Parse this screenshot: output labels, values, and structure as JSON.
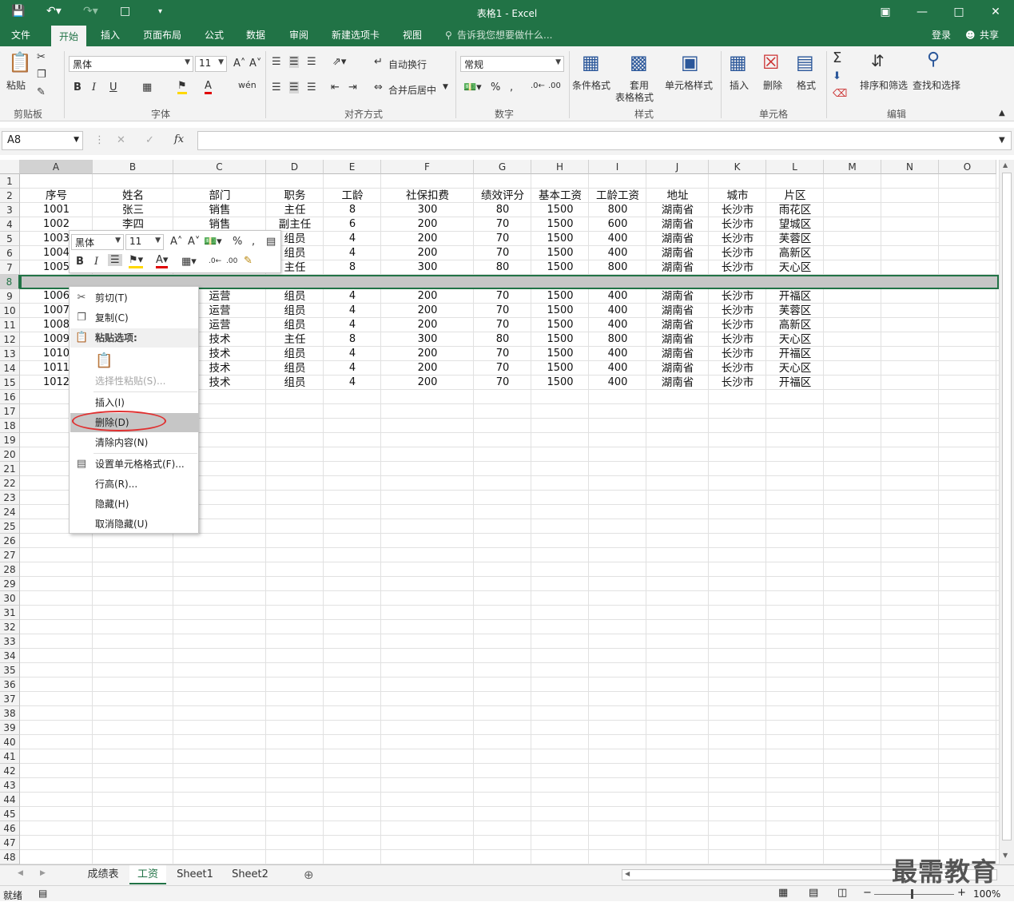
{
  "window": {
    "title": "表格1 - Excel"
  },
  "tabs": [
    "文件",
    "开始",
    "插入",
    "页面布局",
    "公式",
    "数据",
    "审阅",
    "新建选项卡",
    "视图"
  ],
  "tellme": "告诉我您想要做什么...",
  "account": {
    "login": "登录",
    "share": "共享"
  },
  "ribbon": {
    "paste": "粘贴",
    "font_name": "黑体",
    "font_size": "11",
    "wrap_text": "自动换行",
    "merge_center": "合并后居中",
    "number_format": "常规",
    "cond_format": "条件格式",
    "table_format_1": "套用",
    "table_format_2": "表格格式",
    "cell_styles": "单元格样式",
    "insert": "插入",
    "delete": "删除",
    "format": "格式",
    "sort_filter": "排序和筛选",
    "find_select": "查找和选择",
    "groups": {
      "clipboard": "剪贴板",
      "font": "字体",
      "align": "对齐方式",
      "number": "数字",
      "styles": "样式",
      "cells": "单元格",
      "editing": "编辑"
    }
  },
  "formula_bar": {
    "name_box": "A8",
    "fx": "fx"
  },
  "columns": [
    "A",
    "B",
    "C",
    "D",
    "E",
    "F",
    "G",
    "H",
    "I",
    "J",
    "K",
    "L",
    "M",
    "N",
    "O"
  ],
  "table": {
    "headers": [
      "序号",
      "姓名",
      "部门",
      "职务",
      "工龄",
      "社保扣费",
      "绩效评分",
      "基本工资",
      "工龄工资",
      "地址",
      "城市",
      "片区"
    ],
    "rows": [
      {
        "r": 3,
        "cells": [
          "1001",
          "张三",
          "销售",
          "主任",
          "8",
          "300",
          "80",
          "1500",
          "800",
          "湖南省",
          "长沙市",
          "雨花区"
        ]
      },
      {
        "r": 4,
        "cells": [
          "1002",
          "李四",
          "销售",
          "副主任",
          "6",
          "200",
          "70",
          "1500",
          "600",
          "湖南省",
          "长沙市",
          "望城区"
        ]
      },
      {
        "r": 5,
        "cells": [
          "1003",
          "",
          "",
          "组员",
          "4",
          "200",
          "70",
          "1500",
          "400",
          "湖南省",
          "长沙市",
          "芙蓉区"
        ]
      },
      {
        "r": 6,
        "cells": [
          "1004",
          "",
          "",
          "组员",
          "4",
          "200",
          "70",
          "1500",
          "400",
          "湖南省",
          "长沙市",
          "高新区"
        ]
      },
      {
        "r": 7,
        "cells": [
          "1005",
          "",
          "",
          "主任",
          "8",
          "300",
          "80",
          "1500",
          "800",
          "湖南省",
          "长沙市",
          "天心区"
        ]
      },
      {
        "r": 9,
        "cells": [
          "1006",
          "",
          "运营",
          "组员",
          "4",
          "200",
          "70",
          "1500",
          "400",
          "湖南省",
          "长沙市",
          "开福区"
        ]
      },
      {
        "r": 10,
        "cells": [
          "1007",
          "",
          "运营",
          "组员",
          "4",
          "200",
          "70",
          "1500",
          "400",
          "湖南省",
          "长沙市",
          "芙蓉区"
        ]
      },
      {
        "r": 11,
        "cells": [
          "1008",
          "",
          "运营",
          "组员",
          "4",
          "200",
          "70",
          "1500",
          "400",
          "湖南省",
          "长沙市",
          "高新区"
        ]
      },
      {
        "r": 12,
        "cells": [
          "1009",
          "",
          "技术",
          "主任",
          "8",
          "300",
          "80",
          "1500",
          "800",
          "湖南省",
          "长沙市",
          "天心区"
        ]
      },
      {
        "r": 13,
        "cells": [
          "1010",
          "",
          "技术",
          "组员",
          "4",
          "200",
          "70",
          "1500",
          "400",
          "湖南省",
          "长沙市",
          "开福区"
        ]
      },
      {
        "r": 14,
        "cells": [
          "1011",
          "",
          "技术",
          "组员",
          "4",
          "200",
          "70",
          "1500",
          "400",
          "湖南省",
          "长沙市",
          "天心区"
        ]
      },
      {
        "r": 15,
        "cells": [
          "1012",
          "",
          "技术",
          "组员",
          "4",
          "200",
          "70",
          "1500",
          "400",
          "湖南省",
          "长沙市",
          "开福区"
        ]
      }
    ]
  },
  "mini_toolbar": {
    "font": "黑体",
    "size": "11"
  },
  "context_menu": {
    "cut": "剪切(T)",
    "copy": "复制(C)",
    "paste_options": "粘贴选项:",
    "paste_special": "选择性粘贴(S)...",
    "insert": "插入(I)",
    "delete": "删除(D)",
    "clear": "清除内容(N)",
    "format_cells": "设置单元格格式(F)...",
    "row_height": "行高(R)...",
    "hide": "隐藏(H)",
    "unhide": "取消隐藏(U)"
  },
  "sheets": [
    "成绩表",
    "工资",
    "Sheet1",
    "Sheet2"
  ],
  "status": {
    "ready": "就绪",
    "zoom": "100%"
  },
  "watermark": "最需教育",
  "colors": {
    "accent": "#217346",
    "highlight_oval": "#e03030"
  }
}
